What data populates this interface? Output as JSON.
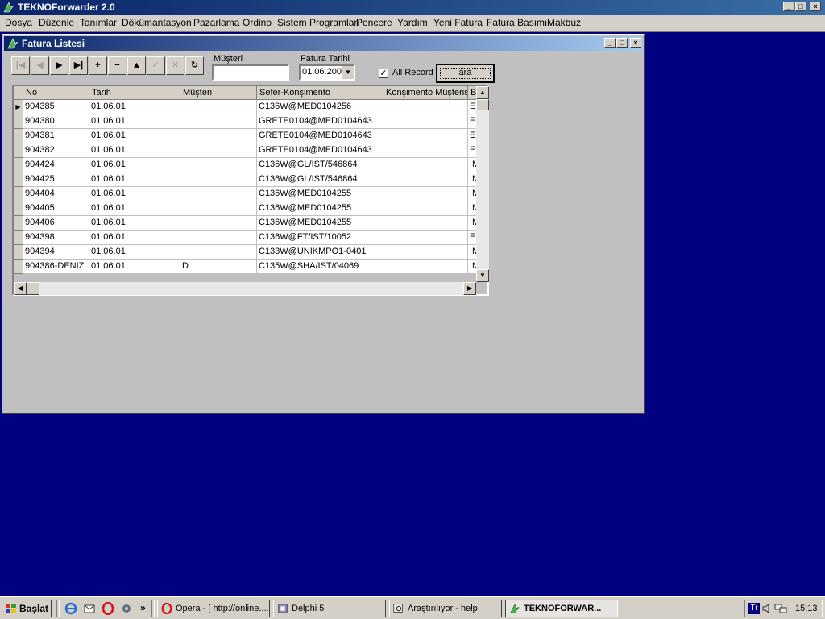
{
  "app": {
    "title": "TEKNOForwarder 2.0",
    "controls": {
      "minimize": "_",
      "maximize": "□",
      "close": "×"
    }
  },
  "menu": [
    "Dosya",
    "Düzenle",
    "Tanımlar",
    "Dökümantasyon",
    "Pazarlama",
    "Ordino",
    "Sistem Programları",
    "Pencere",
    "Yardım",
    "Yeni Fatura",
    "Fatura Basımı",
    "Makbuz"
  ],
  "window": {
    "title": "Fatura Listesi",
    "controls": {
      "minimize": "_",
      "maximize": "□",
      "close": "×"
    }
  },
  "navigator": [
    {
      "name": "first-record",
      "glyph": "|◀",
      "enabled": false
    },
    {
      "name": "prior-record",
      "glyph": "◀",
      "enabled": false
    },
    {
      "name": "next-record",
      "glyph": "▶",
      "enabled": true
    },
    {
      "name": "last-record",
      "glyph": "▶|",
      "enabled": true
    },
    {
      "name": "insert-record",
      "glyph": "+",
      "enabled": true
    },
    {
      "name": "delete-record",
      "glyph": "−",
      "enabled": true
    },
    {
      "name": "edit-record",
      "glyph": "▲",
      "enabled": true
    },
    {
      "name": "post-record",
      "glyph": "✓",
      "enabled": false
    },
    {
      "name": "cancel-record",
      "glyph": "✕",
      "enabled": false
    },
    {
      "name": "refresh-records",
      "glyph": "↻",
      "enabled": true
    }
  ],
  "filters": {
    "musteri_label": "Müşteri",
    "musteri_value": "",
    "fatura_tarihi_label": "Fatura Tarihi",
    "fatura_tarihi_value": "01.06.200",
    "all_record_label": "All Record",
    "all_record_checked": true,
    "search_button": "ara"
  },
  "grid": {
    "columns": [
      "No",
      "Tarih",
      "Müşteri",
      "Sefer-Konşimento",
      "Konşimento Müşterisi",
      "B"
    ],
    "rows": [
      {
        "no": "904385",
        "tarih": "01.06.01",
        "musteri": "",
        "sefer": "C136W@MED0104256",
        "konsimento_musterisi": "",
        "b": "EX",
        "current": true
      },
      {
        "no": "904380",
        "tarih": "01.06.01",
        "musteri": "",
        "sefer": "GRETE0104@MED0104643",
        "konsimento_musterisi": "",
        "b": "EX"
      },
      {
        "no": "904381",
        "tarih": "01.06.01",
        "musteri": "",
        "sefer": "GRETE0104@MED0104643",
        "konsimento_musterisi": "",
        "b": "EX"
      },
      {
        "no": "904382",
        "tarih": "01.06.01",
        "musteri": "",
        "sefer": "GRETE0104@MED0104643",
        "konsimento_musterisi": "",
        "b": "EX"
      },
      {
        "no": "904424",
        "tarih": "01.06.01",
        "musteri": "",
        "sefer": "C136W@GL/IST/546864",
        "konsimento_musterisi": "",
        "b": "IM"
      },
      {
        "no": "904425",
        "tarih": "01.06.01",
        "musteri": "",
        "sefer": "C136W@GL/IST/546864",
        "konsimento_musterisi": "",
        "b": "IM"
      },
      {
        "no": "904404",
        "tarih": "01.06.01",
        "musteri": "",
        "sefer": "C136W@MED0104255",
        "konsimento_musterisi": "",
        "b": "IM"
      },
      {
        "no": "904405",
        "tarih": "01.06.01",
        "musteri": "",
        "sefer": "C136W@MED0104255",
        "konsimento_musterisi": "",
        "b": "IM"
      },
      {
        "no": "904406",
        "tarih": "01.06.01",
        "musteri": "",
        "sefer": "C136W@MED0104255",
        "konsimento_musterisi": "",
        "b": "IM"
      },
      {
        "no": "904398",
        "tarih": "01.06.01",
        "musteri": "",
        "sefer": "C136W@FT/IST/10052",
        "konsimento_musterisi": "",
        "b": "EX"
      },
      {
        "no": "904394",
        "tarih": "01.06.01",
        "musteri": "",
        "sefer": "C133W@UNIKMPO1-0401",
        "konsimento_musterisi": "",
        "b": "IM"
      },
      {
        "no": "904386-DENIZ",
        "tarih": "01.06.01",
        "musteri": "D",
        "sefer": "C135W@SHA/IST/04069",
        "konsimento_musterisi": "",
        "b": "IM"
      }
    ]
  },
  "taskbar": {
    "start_label": "Başlat",
    "more_glyph": "»",
    "tasks": [
      {
        "label": "Opera - [ http://online....",
        "active": false
      },
      {
        "label": "Delphi 5",
        "active": false
      },
      {
        "label": "Araştırılıyor - help",
        "active": false
      },
      {
        "label": "TEKNOFORWAR...",
        "active": true
      }
    ],
    "tray_lang": "Tr",
    "clock": "15:13"
  },
  "colors": {
    "desktop": "#000080",
    "title_active": "#0a246a",
    "face": "#d4d0c8"
  }
}
